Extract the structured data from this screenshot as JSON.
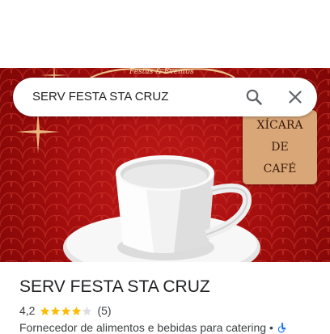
{
  "search": {
    "query": "SERV FESTA STA CRUZ"
  },
  "photo": {
    "logo_text": "Festas & Eventos",
    "note_lines": [
      "XÍCARA",
      "DE",
      "CAFÉ"
    ]
  },
  "place": {
    "name": "SERV FESTA STA CRUZ",
    "rating": "4,2",
    "stars": 4.2,
    "reviews": "(5)",
    "category": "Fornecedor de alimentos e bebidas para catering",
    "separator": "•"
  },
  "colors": {
    "star": "#fbbc04",
    "star_empty": "#dadce0",
    "icon": "#5f6368"
  }
}
